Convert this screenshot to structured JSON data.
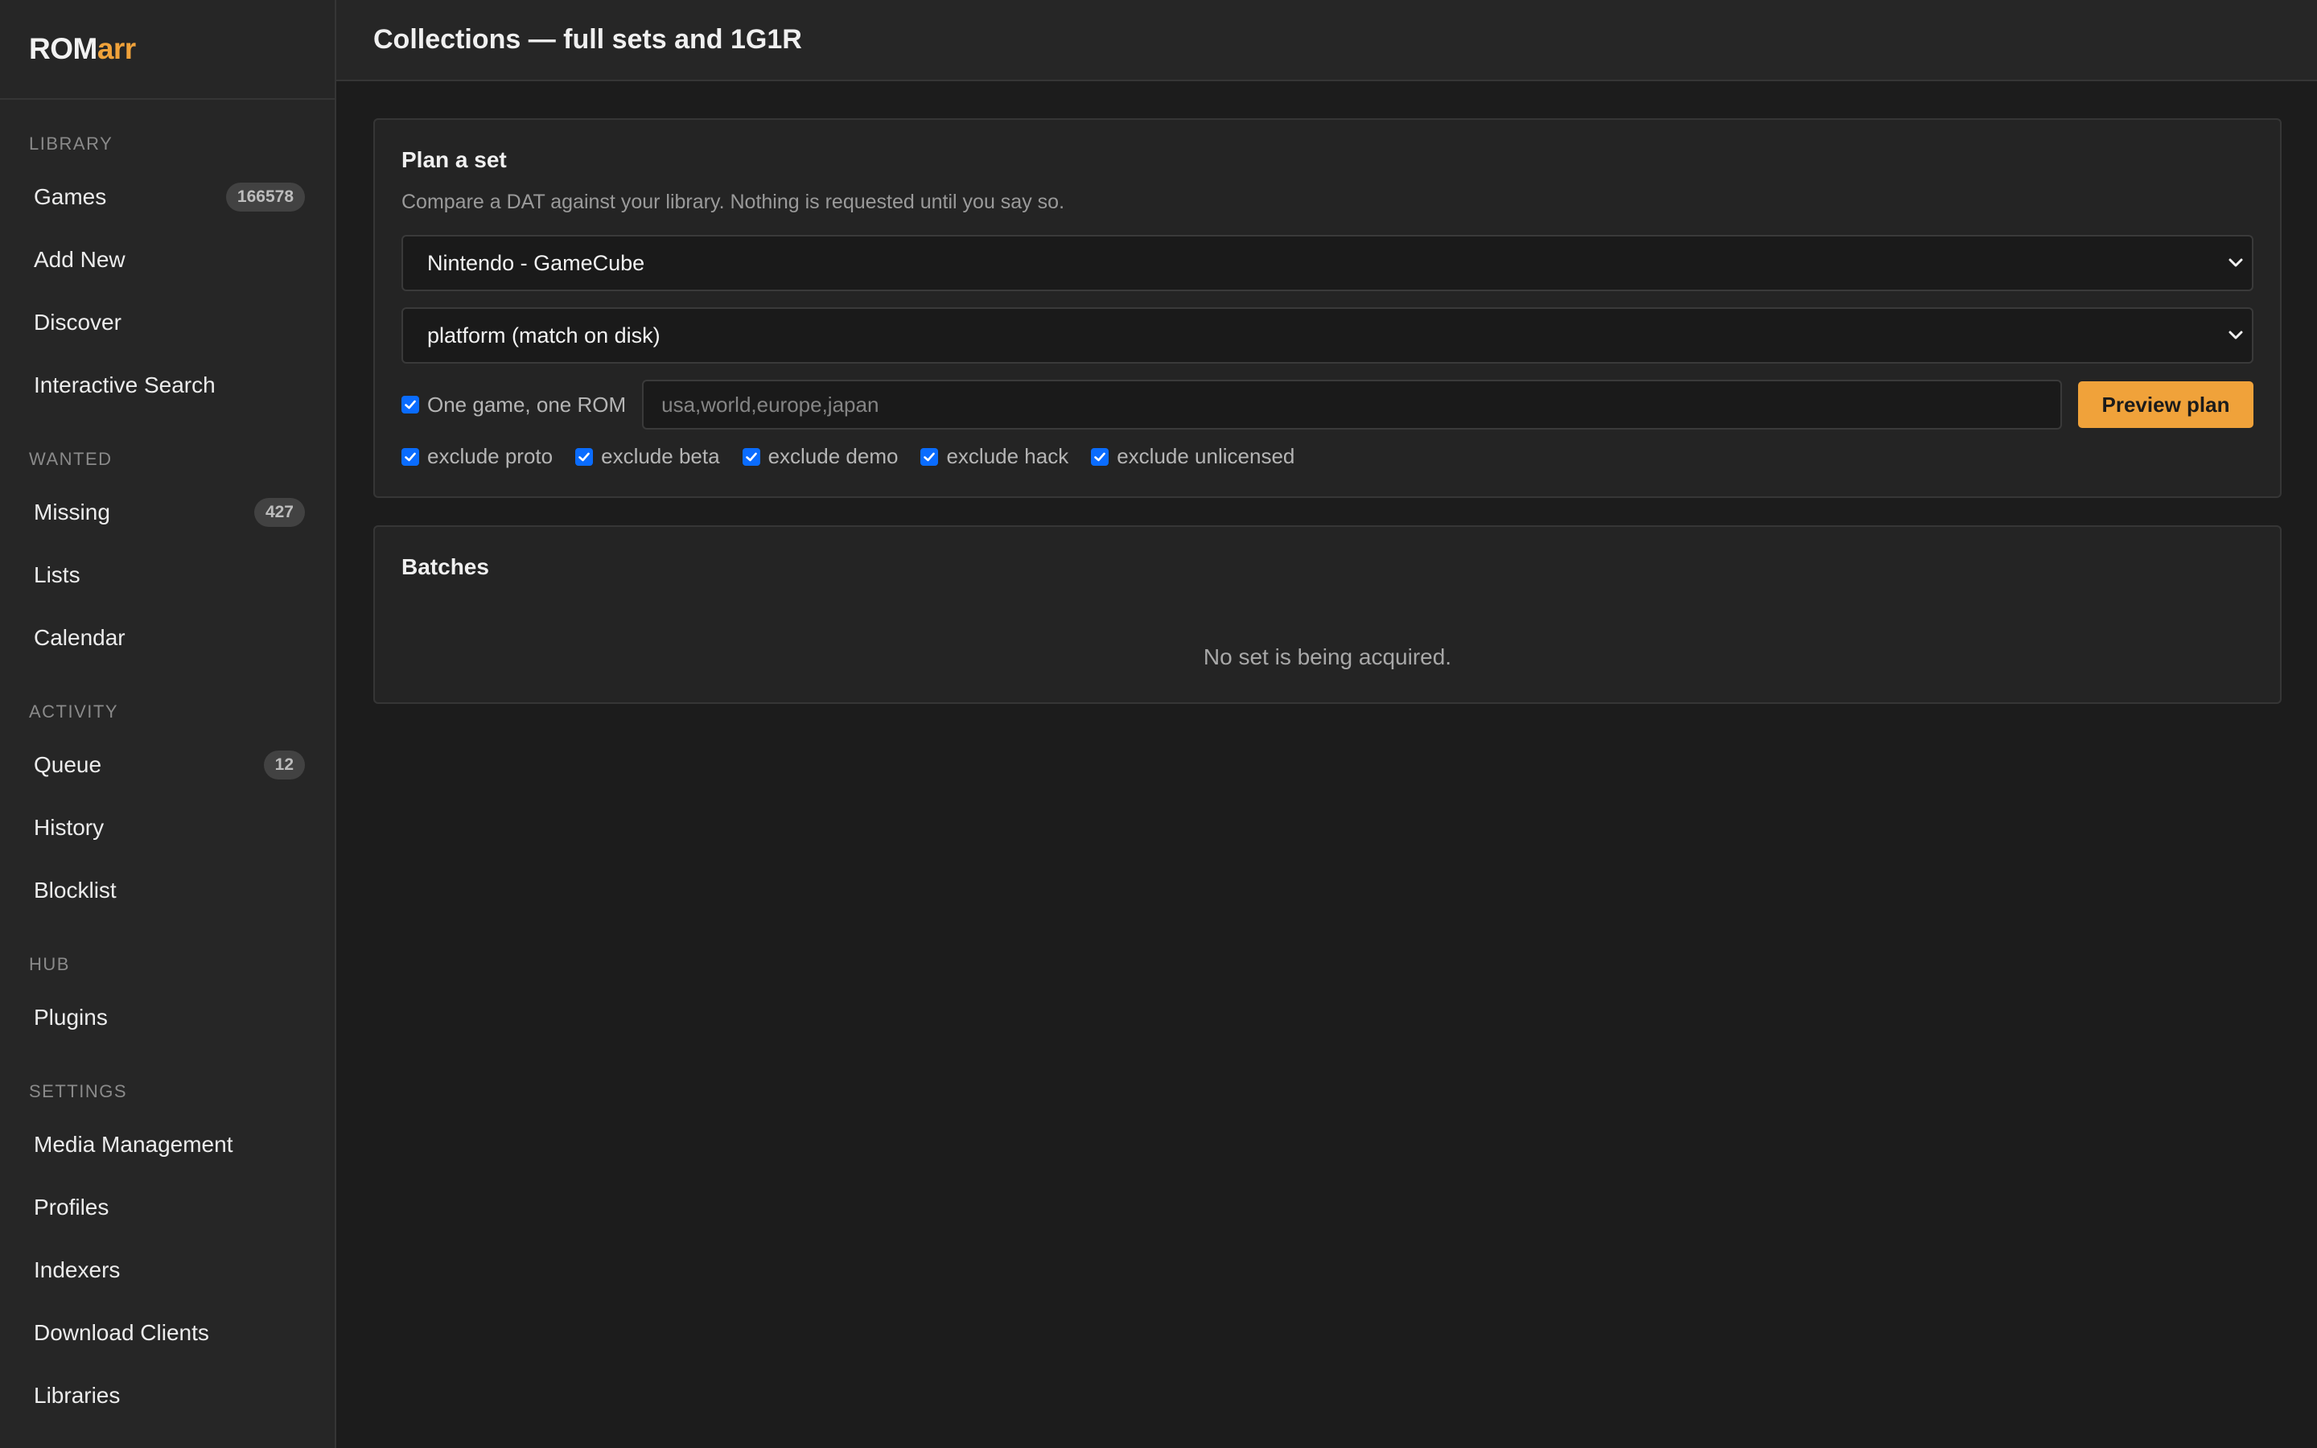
{
  "app": {
    "logo_main": "ROM",
    "logo_accent": "arr"
  },
  "sidebar": {
    "sections": [
      {
        "title": "LIBRARY",
        "items": [
          {
            "label": "Games",
            "badge": "166578"
          },
          {
            "label": "Add New"
          },
          {
            "label": "Discover"
          },
          {
            "label": "Interactive Search"
          }
        ]
      },
      {
        "title": "WANTED",
        "items": [
          {
            "label": "Missing",
            "badge": "427"
          },
          {
            "label": "Lists"
          },
          {
            "label": "Calendar"
          }
        ]
      },
      {
        "title": "ACTIVITY",
        "items": [
          {
            "label": "Queue",
            "badge": "12"
          },
          {
            "label": "History"
          },
          {
            "label": "Blocklist"
          }
        ]
      },
      {
        "title": "HUB",
        "items": [
          {
            "label": "Plugins"
          }
        ]
      },
      {
        "title": "SETTINGS",
        "items": [
          {
            "label": "Media Management"
          },
          {
            "label": "Profiles"
          },
          {
            "label": "Indexers"
          },
          {
            "label": "Download Clients"
          },
          {
            "label": "Libraries"
          }
        ]
      }
    ]
  },
  "header": {
    "title": "Collections — full sets and 1G1R"
  },
  "plan": {
    "title": "Plan a set",
    "description": "Compare a DAT against your library. Nothing is requested until you say so.",
    "dat_select": {
      "value": "Nintendo - GameCube"
    },
    "mode_select": {
      "value": "platform (match on disk)"
    },
    "one_game_one_rom": {
      "label": "One game, one ROM",
      "checked": true
    },
    "regions_input": {
      "value": "",
      "placeholder": "usa,world,europe,japan"
    },
    "preview_button": "Preview plan",
    "exclusions": [
      {
        "label": "exclude proto",
        "checked": true
      },
      {
        "label": "exclude beta",
        "checked": true
      },
      {
        "label": "exclude demo",
        "checked": true
      },
      {
        "label": "exclude hack",
        "checked": true
      },
      {
        "label": "exclude unlicensed",
        "checked": true
      }
    ]
  },
  "batches": {
    "title": "Batches",
    "empty_message": "No set is being acquired."
  },
  "colors": {
    "accent": "#f0a23a",
    "checkbox": "#0a6cff",
    "background": "#1c1c1c",
    "panel": "#242424",
    "sidebar": "#262626"
  }
}
